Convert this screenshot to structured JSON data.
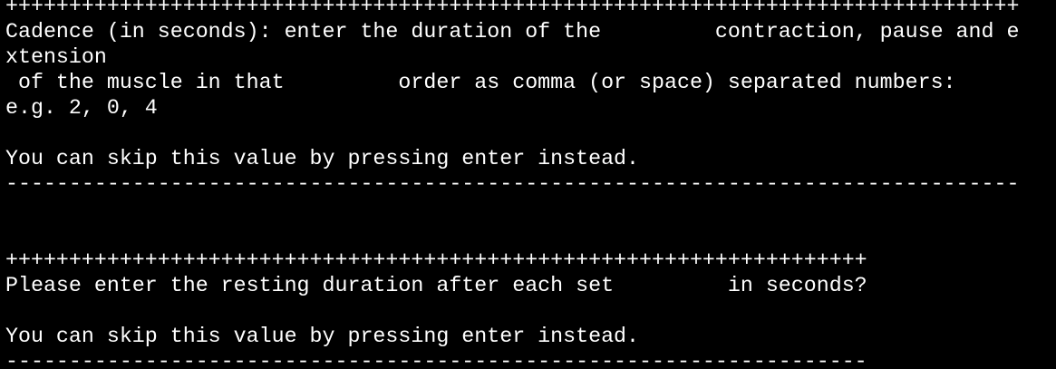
{
  "terminal": {
    "lines": [
      "++++++++++++++++++++++++++++++++++++++++++++++++++++++++++++++++++++++++++++++++",
      "Cadence (in seconds): enter the duration of the         contraction, pause and e",
      "xtension",
      " of the muscle in that         order as comma (or space) separated numbers:",
      "e.g. 2, 0, 4",
      "",
      "You can skip this value by pressing enter instead.",
      "--------------------------------------------------------------------------------",
      "",
      "",
      "++++++++++++++++++++++++++++++++++++++++++++++++++++++++++++++++++++",
      "Please enter the resting duration after each set         in seconds?",
      "",
      "You can skip this value by pressing enter instead.",
      "--------------------------------------------------------------------"
    ]
  }
}
